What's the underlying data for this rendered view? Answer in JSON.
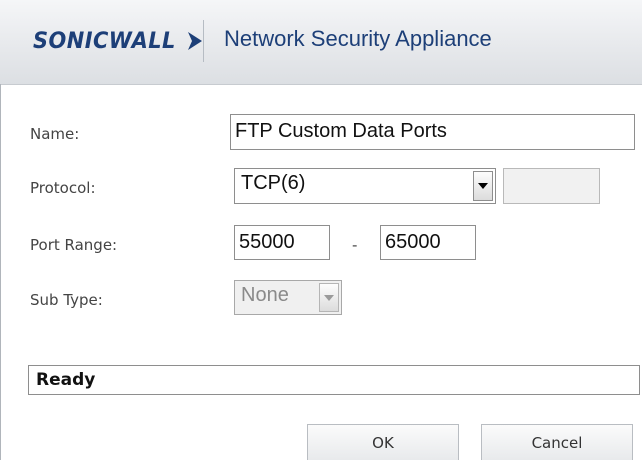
{
  "header": {
    "logo_text": "SONICWALL",
    "title": "Network Security Appliance",
    "brand_color": "#1d3f78"
  },
  "form": {
    "name_label": "Name:",
    "name_value": "FTP Custom Data Ports",
    "protocol_label": "Protocol:",
    "protocol_value": "TCP(6)",
    "protocol_number_value": "",
    "port_range_label": "Port Range:",
    "port_start": "55000",
    "port_separator": "-",
    "port_end": "65000",
    "sub_type_label": "Sub Type:",
    "sub_type_value": "None"
  },
  "status": {
    "text": "Ready"
  },
  "buttons": {
    "ok": "OK",
    "cancel": "Cancel"
  }
}
